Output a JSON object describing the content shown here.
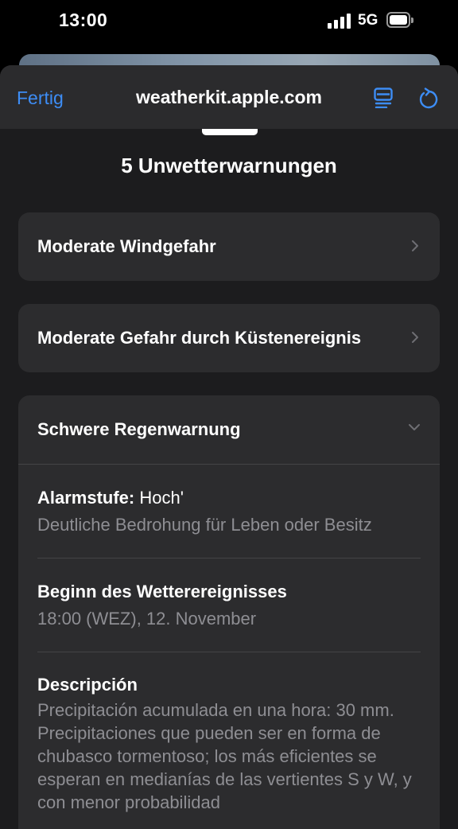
{
  "status_bar": {
    "time": "13:00",
    "network": "5G"
  },
  "browser": {
    "done_label": "Fertig",
    "url": "weatherkit.apple.com",
    "accent_color": "#3d8df5"
  },
  "page": {
    "title": "5 Unwetterwarnungen"
  },
  "alerts": [
    {
      "label": "Moderate Windgefahr",
      "expanded": false
    },
    {
      "label": "Moderate Gefahr durch Küstenereignis",
      "expanded": false
    },
    {
      "label": "Schwere Regenwarnung",
      "expanded": true,
      "details": {
        "level_label": "Alarmstufe:",
        "level_value": "Hoch'",
        "level_desc": "Deutliche Bedrohung für Leben oder Besitz",
        "start_label": "Beginn des Wetterereignisses",
        "start_value": "18:00 (WEZ), 12. November",
        "desc_label": "Descripción",
        "desc_text": "Precipitación acumulada en una hora: 30 mm. Precipitaciones que pueden ser en forma de chubasco tormentoso; los más eficientes se esperan en medianías de las vertientes S y W, y con menor probabilidad"
      }
    }
  ]
}
